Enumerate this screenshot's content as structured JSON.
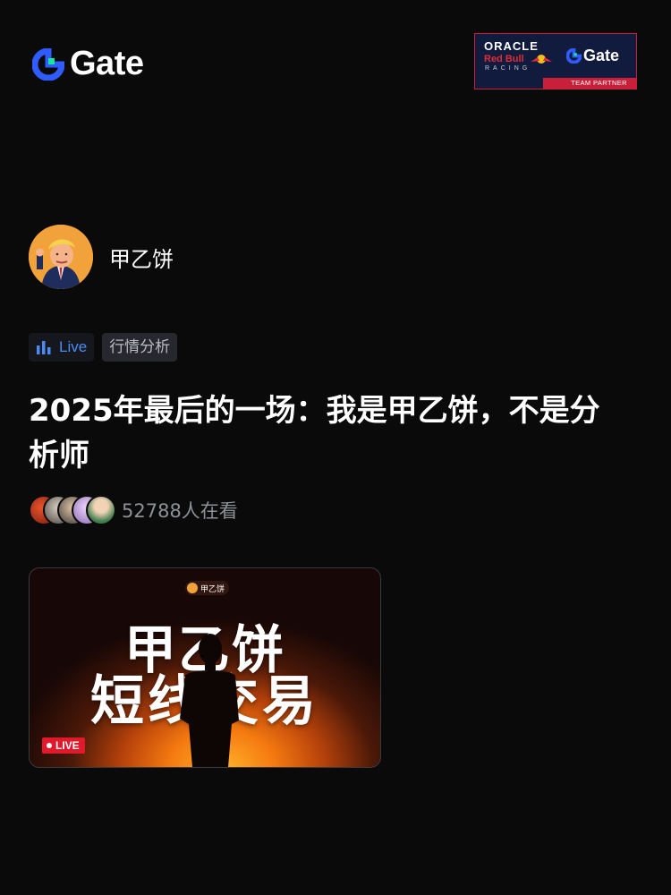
{
  "brand": {
    "name": "Gate"
  },
  "partner_badge": {
    "oracle": "ORACLE",
    "red_bull": "Red Bull",
    "racing": "RACING",
    "gate": "Gate",
    "team_partner": "TEAM PARTNER"
  },
  "host": {
    "name": "甲乙饼",
    "avatar_icon": "host-avatar"
  },
  "tags": {
    "live": "Live",
    "category": "行情分析"
  },
  "title": "2025年最后的一场：我是甲乙饼，不是分析师",
  "viewers": {
    "count_text": "52788人在看"
  },
  "stream_thumbnail": {
    "channel_chip": "甲乙饼",
    "line1": "甲乙饼",
    "line2": "短线交易",
    "live_badge": "LIVE"
  },
  "colors": {
    "background": "#0a0a0a",
    "accent_blue": "#4c8bf5",
    "brand_green": "#17e6a1",
    "live_red": "#e0192b"
  }
}
